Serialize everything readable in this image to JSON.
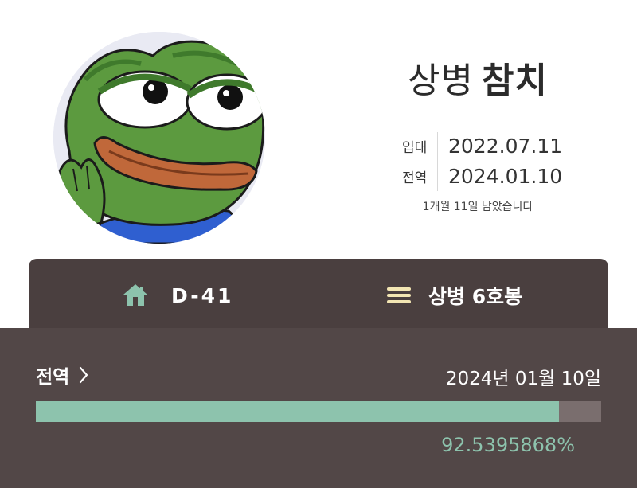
{
  "profile": {
    "rank": "상병",
    "nickname": "참치",
    "enlist_label": "입대",
    "enlist_date": "2022.07.11",
    "discharge_label": "전역",
    "discharge_date": "2024.01.10",
    "remaining_text": "1개월 11일 남았습니다"
  },
  "status": {
    "home_icon": "home-icon",
    "dday": "D-41",
    "menu_icon": "menu-icon",
    "grade": "상병 6호봉"
  },
  "discharge_panel": {
    "label": "전역",
    "date": "2024년 01월 10일",
    "progress_percent": 92.5395868,
    "progress_text": "92.5395868%"
  },
  "colors": {
    "accent": "#8dc3ad",
    "status_bar": "#4a3f3f",
    "panel": "#524747",
    "track": "#7a6e6e"
  }
}
